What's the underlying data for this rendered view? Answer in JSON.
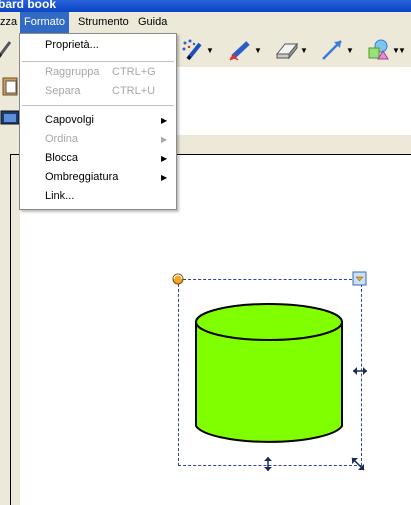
{
  "window": {
    "title": "bard book"
  },
  "menubar": {
    "items": [
      {
        "label": "zza",
        "active": false
      },
      {
        "label": "Formato",
        "active": true
      },
      {
        "label": "Strumento",
        "active": false
      },
      {
        "label": "Guida",
        "active": false
      }
    ]
  },
  "format_menu": {
    "items": [
      {
        "label": "Proprietà...",
        "shortcut": "",
        "submenu": false,
        "enabled": true
      },
      {
        "label": "Raggruppa",
        "shortcut": "CTRL+G",
        "submenu": false,
        "enabled": false
      },
      {
        "label": "Separa",
        "shortcut": "CTRL+U",
        "submenu": false,
        "enabled": false
      },
      {
        "label": "Capovolgi",
        "shortcut": "",
        "submenu": true,
        "enabled": true
      },
      {
        "label": "Ordina",
        "shortcut": "",
        "submenu": true,
        "enabled": false
      },
      {
        "label": "Blocca",
        "shortcut": "",
        "submenu": true,
        "enabled": true
      },
      {
        "label": "Ombreggiatura",
        "shortcut": "",
        "submenu": true,
        "enabled": true
      },
      {
        "label": "Link...",
        "shortcut": "",
        "submenu": false,
        "enabled": true
      }
    ],
    "submenu_arrow": "▶"
  },
  "toolbar": {
    "tools": [
      {
        "icon": "magic-pen-icon"
      },
      {
        "icon": "highlighter-icon"
      },
      {
        "icon": "eraser-icon"
      },
      {
        "icon": "line-icon"
      },
      {
        "icon": "shapes-icon"
      }
    ],
    "dropdown_arrow": "▼"
  },
  "canvas": {
    "shape": {
      "icon": "cylinder-shape",
      "fill": "#80ff00",
      "stroke": "#000000"
    },
    "selection_color": "#3040a0"
  }
}
